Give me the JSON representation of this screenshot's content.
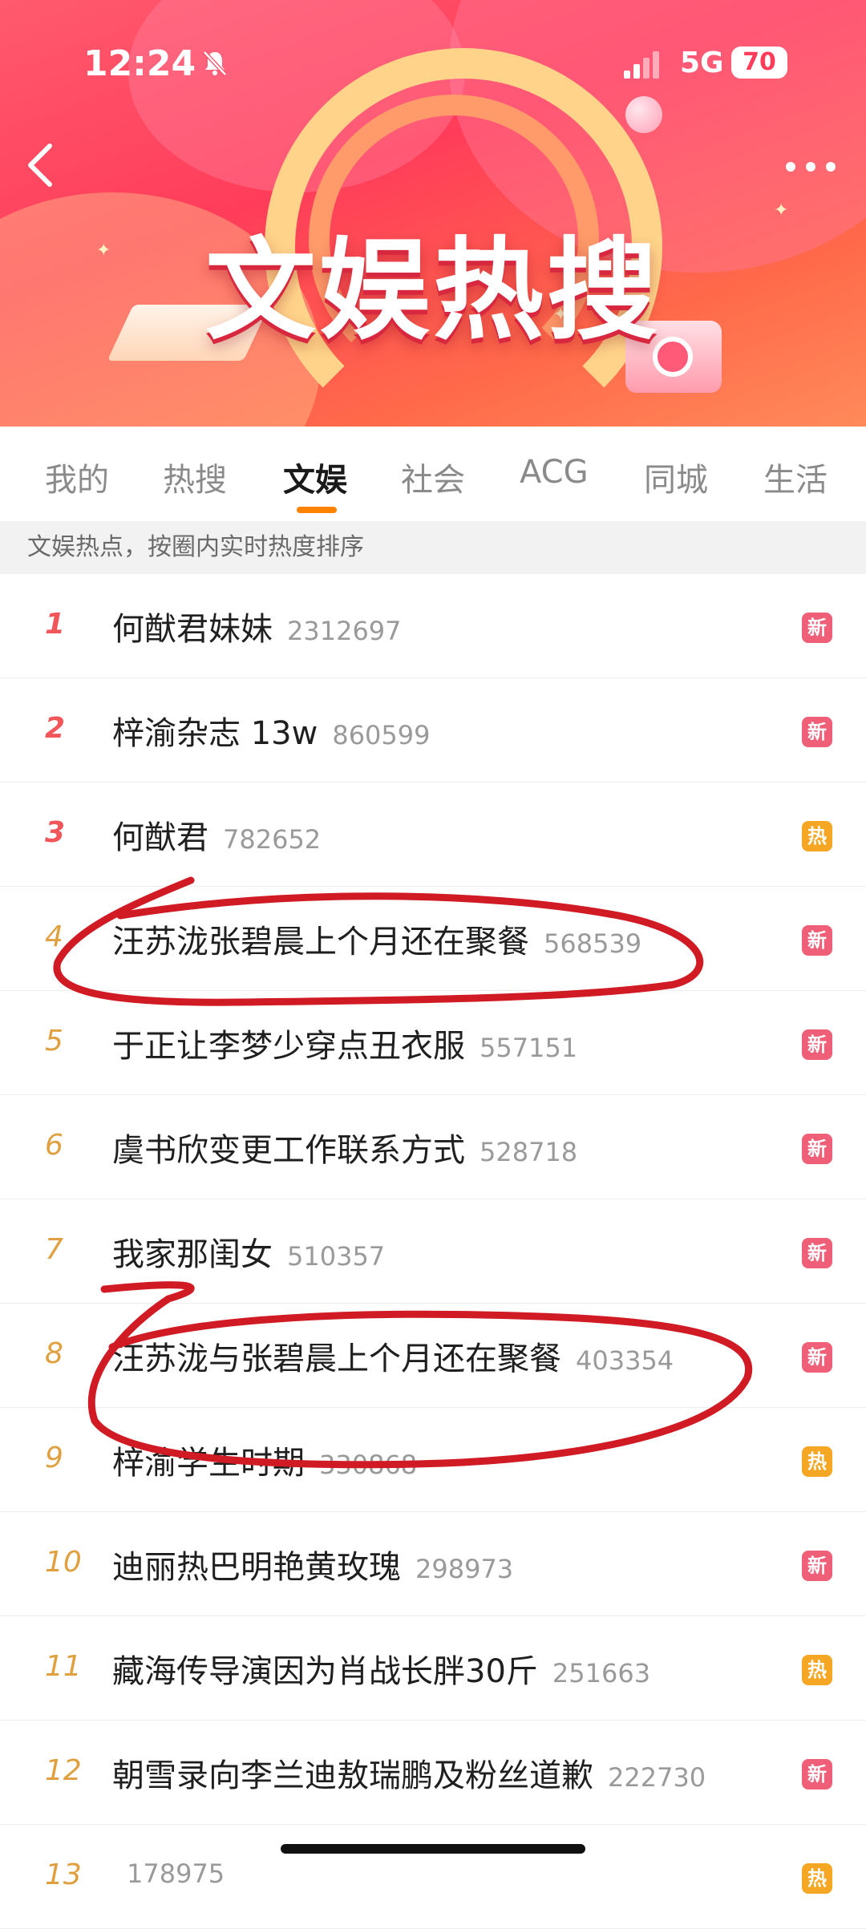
{
  "status_bar": {
    "time": "12:24",
    "network": "5G",
    "battery": "70"
  },
  "header": {
    "title": "文娱热搜"
  },
  "tabs": [
    {
      "label": "我的"
    },
    {
      "label": "热搜"
    },
    {
      "label": "文娱",
      "active": true
    },
    {
      "label": "社会"
    },
    {
      "label": "ACG"
    },
    {
      "label": "同城"
    },
    {
      "label": "生活"
    }
  ],
  "subtitle": "文娱热点，按圈内实时热度排序",
  "items": [
    {
      "rank": "1",
      "topic": "何猷君妹妹",
      "heat": "2312697",
      "badge": "新",
      "badge_type": "new"
    },
    {
      "rank": "2",
      "topic": "梓渝杂志 13w",
      "heat": "860599",
      "badge": "新",
      "badge_type": "new"
    },
    {
      "rank": "3",
      "topic": "何猷君",
      "heat": "782652",
      "badge": "热",
      "badge_type": "hot"
    },
    {
      "rank": "4",
      "topic": "汪苏泷张碧晨上个月还在聚餐",
      "heat": "568539",
      "badge": "新",
      "badge_type": "new"
    },
    {
      "rank": "5",
      "topic": "于正让李梦少穿点丑衣服",
      "heat": "557151",
      "badge": "新",
      "badge_type": "new"
    },
    {
      "rank": "6",
      "topic": "虞书欣变更工作联系方式",
      "heat": "528718",
      "badge": "新",
      "badge_type": "new"
    },
    {
      "rank": "7",
      "topic": "我家那闺女",
      "heat": "510357",
      "badge": "新",
      "badge_type": "new"
    },
    {
      "rank": "8",
      "topic": "汪苏泷与张碧晨上个月还在聚餐",
      "heat": "403354",
      "badge": "新",
      "badge_type": "new"
    },
    {
      "rank": "9",
      "topic": "梓渝学生时期",
      "heat": "330868",
      "badge": "热",
      "badge_type": "hot"
    },
    {
      "rank": "10",
      "topic": "迪丽热巴明艳黄玫瑰",
      "heat": "298973",
      "badge": "新",
      "badge_type": "new"
    },
    {
      "rank": "11",
      "topic": "藏海传导演因为肖战长胖30斤",
      "heat": "251663",
      "badge": "热",
      "badge_type": "hot"
    },
    {
      "rank": "12",
      "topic": "朝雪录向李兰迪敖瑞鹏及粉丝道歉",
      "heat": "222730",
      "badge": "新",
      "badge_type": "new"
    },
    {
      "rank": "13",
      "topic": "",
      "heat": "178975",
      "badge": "热",
      "badge_type": "hot"
    }
  ],
  "colors": {
    "accent": "#ff8200",
    "badge_new": "#ef5f78",
    "badge_hot": "#f5a623",
    "annotation": "#d11b24"
  }
}
